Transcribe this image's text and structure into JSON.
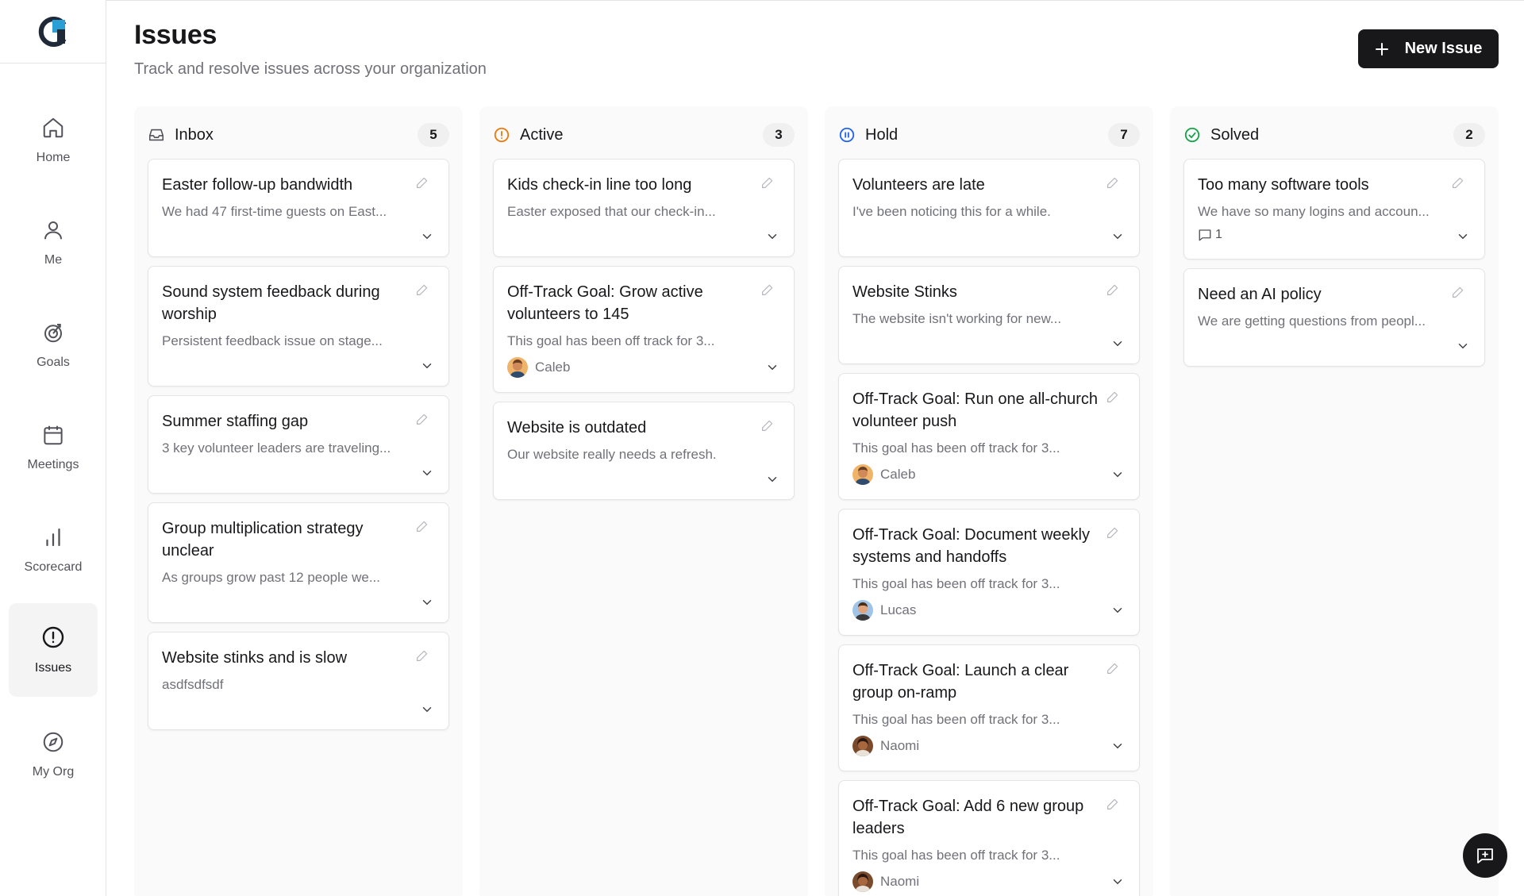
{
  "nav": {
    "items": [
      {
        "label": "Home"
      },
      {
        "label": "Me"
      },
      {
        "label": "Goals"
      },
      {
        "label": "Meetings"
      },
      {
        "label": "Scorecard"
      },
      {
        "label": "Issues"
      },
      {
        "label": "My Org"
      }
    ],
    "active": "Issues"
  },
  "header": {
    "title": "Issues",
    "subtitle": "Track and resolve issues across your organization",
    "new_issue_label": "New Issue"
  },
  "colors": {
    "accent": "#18181b",
    "active_status": "#ea7a0c",
    "hold_status": "#2563eb",
    "solved_status": "#16a34a",
    "logo_blue": "#2a9fd6"
  },
  "columns": [
    {
      "name": "Inbox",
      "count": "5",
      "cards": [
        {
          "title": "Easter follow-up bandwidth",
          "desc": "We had 47 first-time guests on East..."
        },
        {
          "title": "Sound system feedback during worship",
          "desc": "Persistent feedback issue on stage..."
        },
        {
          "title": "Summer staffing gap",
          "desc": "3 key volunteer leaders are traveling..."
        },
        {
          "title": "Group multiplication strategy unclear",
          "desc": "As groups grow past 12 people we..."
        },
        {
          "title": "Website stinks and is slow",
          "desc": "asdfsdfsdf"
        }
      ]
    },
    {
      "name": "Active",
      "count": "3",
      "cards": [
        {
          "title": "Kids check-in line too long",
          "desc": "Easter exposed that our check-in..."
        },
        {
          "title": "Off-Track Goal: Grow active volunteers to 145",
          "desc": "This goal has been off track for 3...",
          "person": "Caleb"
        },
        {
          "title": "Website is outdated",
          "desc": "Our website really needs a refresh."
        }
      ]
    },
    {
      "name": "Hold",
      "count": "7",
      "cards": [
        {
          "title": "Volunteers are late",
          "desc": "I've been noticing this for a while."
        },
        {
          "title": "Website Stinks",
          "desc": "The website isn't working for new..."
        },
        {
          "title": "Off-Track Goal: Run one all-church volunteer push",
          "desc": "This goal has been off track for 3...",
          "person": "Caleb"
        },
        {
          "title": "Off-Track Goal: Document weekly systems and handoffs",
          "desc": "This goal has been off track for 3...",
          "person": "Lucas"
        },
        {
          "title": "Off-Track Goal: Launch a clear group on-ramp",
          "desc": "This goal has been off track for 3...",
          "person": "Naomi"
        },
        {
          "title": "Off-Track Goal: Add 6 new group leaders",
          "desc": "This goal has been off track for 3...",
          "person": "Naomi"
        }
      ]
    },
    {
      "name": "Solved",
      "count": "2",
      "cards": [
        {
          "title": "Too many software tools",
          "desc": "We have so many logins and accoun...",
          "comments": "1"
        },
        {
          "title": "Need an AI policy",
          "desc": "We are getting questions from peopl..."
        }
      ]
    }
  ]
}
